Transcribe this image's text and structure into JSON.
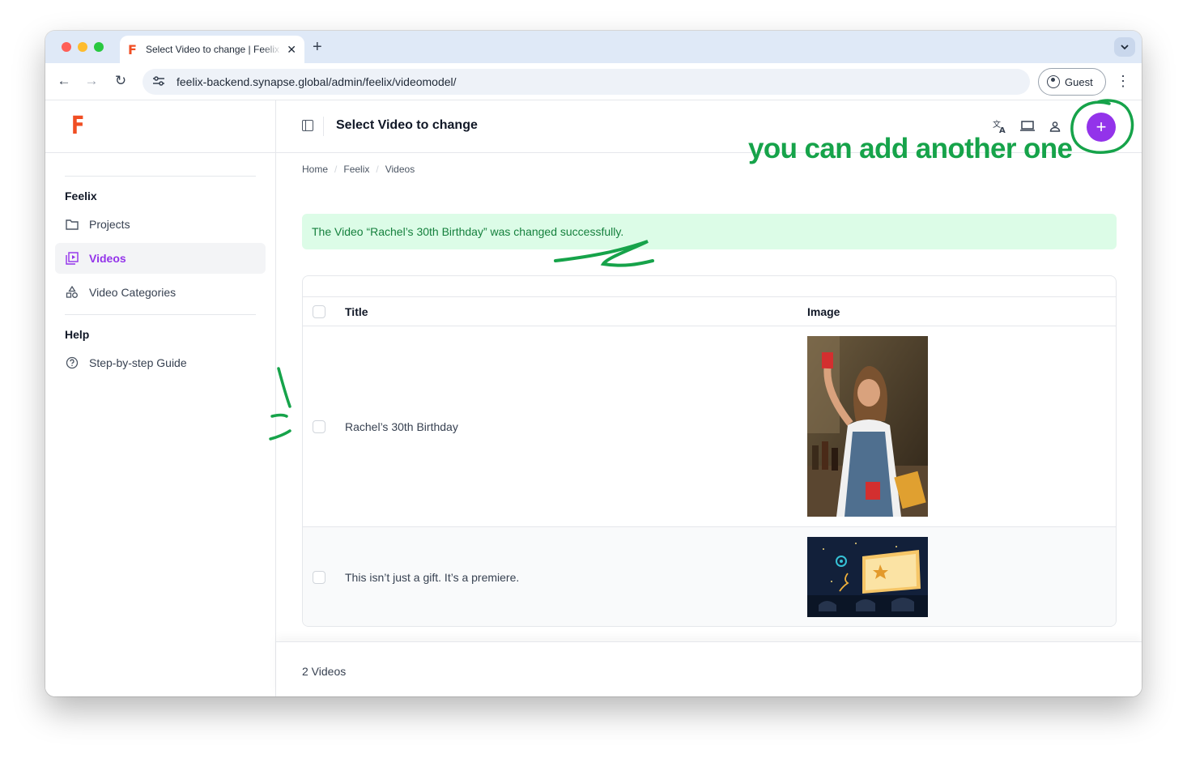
{
  "browser": {
    "tab_title": "Select Video to change | Feelix",
    "tab_favicon": "F",
    "url": "feelix-backend.synapse.global/admin/feelix/videomodel/",
    "profile_label": "Guest"
  },
  "app": {
    "logo": "F",
    "page_title": "Select Video to change",
    "add_button_label": "+",
    "accent_color": "#9333ea",
    "brand_color": "#f04e23"
  },
  "sidebar": {
    "sections": [
      {
        "heading": "Feelix",
        "items": [
          {
            "label": "Projects",
            "icon": "folder-icon",
            "active": false
          },
          {
            "label": "Videos",
            "icon": "video-library-icon",
            "active": true
          },
          {
            "label": "Video Categories",
            "icon": "category-icon",
            "active": false
          }
        ]
      },
      {
        "heading": "Help",
        "items": [
          {
            "label": "Step-by-step Guide",
            "icon": "help-circle-icon",
            "active": false
          }
        ]
      }
    ]
  },
  "breadcrumb": [
    "Home",
    "Feelix",
    "Videos"
  ],
  "alert": {
    "message": "The Video “Rachel’s 30th Birthday” was changed successfully.",
    "color": "#15803d",
    "background": "#dcfce7"
  },
  "table": {
    "headers": [
      "Title",
      "Image"
    ],
    "rows": [
      {
        "title": "Rachel’s 30th Birthday",
        "image": "woman-raising-red-cup-photo"
      },
      {
        "title": "This isn’t just a gift. It’s a premiere.",
        "image": "drive-in-cinema-illustration"
      }
    ]
  },
  "footer": {
    "count": "2 Videos"
  },
  "annotation": {
    "text": "you can add another one",
    "color": "#16a34a"
  }
}
